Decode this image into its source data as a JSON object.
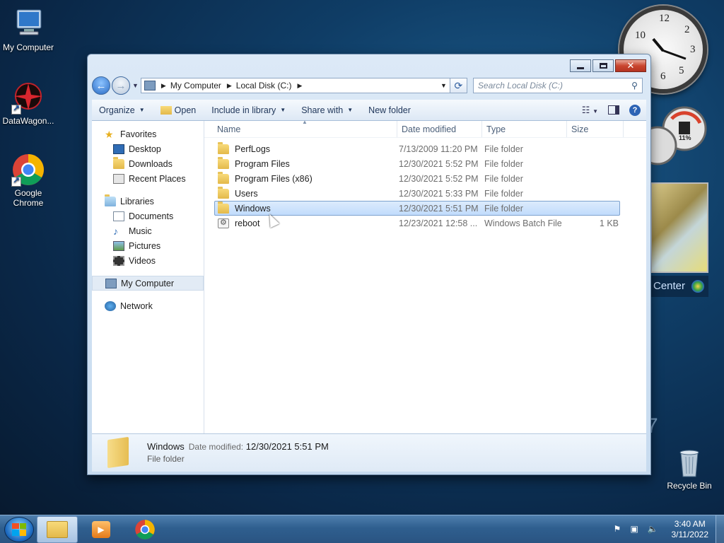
{
  "desktop": {
    "icons": [
      {
        "label": "My Computer"
      },
      {
        "label": "DataWagon..."
      },
      {
        "label": "Google Chrome"
      },
      {
        "label": "Recycle Bin"
      }
    ],
    "gadget_text": {
      "media_center": "Center",
      "win_text": "7",
      "meter_label": "11%"
    }
  },
  "window": {
    "address": {
      "crumbs": [
        "My Computer",
        "Local Disk (C:)"
      ]
    },
    "search": {
      "placeholder": "Search Local Disk (C:)"
    },
    "toolbar": {
      "organize": "Organize",
      "open": "Open",
      "include_in_library": "Include in library",
      "share_with": "Share with",
      "new_folder": "New folder"
    },
    "navpane": {
      "favorites": "Favorites",
      "desktop": "Desktop",
      "downloads": "Downloads",
      "recent_places": "Recent Places",
      "libraries": "Libraries",
      "documents": "Documents",
      "music": "Music",
      "pictures": "Pictures",
      "videos": "Videos",
      "my_computer": "My Computer",
      "network": "Network"
    },
    "columns": {
      "name": "Name",
      "date": "Date modified",
      "type": "Type",
      "size": "Size"
    },
    "files": [
      {
        "name": "PerfLogs",
        "date": "7/13/2009 11:20 PM",
        "type": "File folder",
        "size": ""
      },
      {
        "name": "Program Files",
        "date": "12/30/2021 5:52 PM",
        "type": "File folder",
        "size": ""
      },
      {
        "name": "Program Files (x86)",
        "date": "12/30/2021 5:52 PM",
        "type": "File folder",
        "size": ""
      },
      {
        "name": "Users",
        "date": "12/30/2021 5:33 PM",
        "type": "File folder",
        "size": ""
      },
      {
        "name": "Windows",
        "date": "12/30/2021 5:51 PM",
        "type": "File folder",
        "size": ""
      },
      {
        "name": "reboot",
        "date": "12/23/2021 12:58 ...",
        "type": "Windows Batch File",
        "size": "1 KB"
      }
    ],
    "details": {
      "name": "Windows",
      "date_label": "Date modified:",
      "date_value": "12/30/2021 5:51 PM",
      "type": "File folder"
    }
  },
  "taskbar": {
    "time": "3:40 AM",
    "date": "3/11/2022"
  },
  "colors": {
    "accent": "#2a6bc4",
    "selection": "#c1dcfc",
    "folder": "#e3b94a"
  }
}
